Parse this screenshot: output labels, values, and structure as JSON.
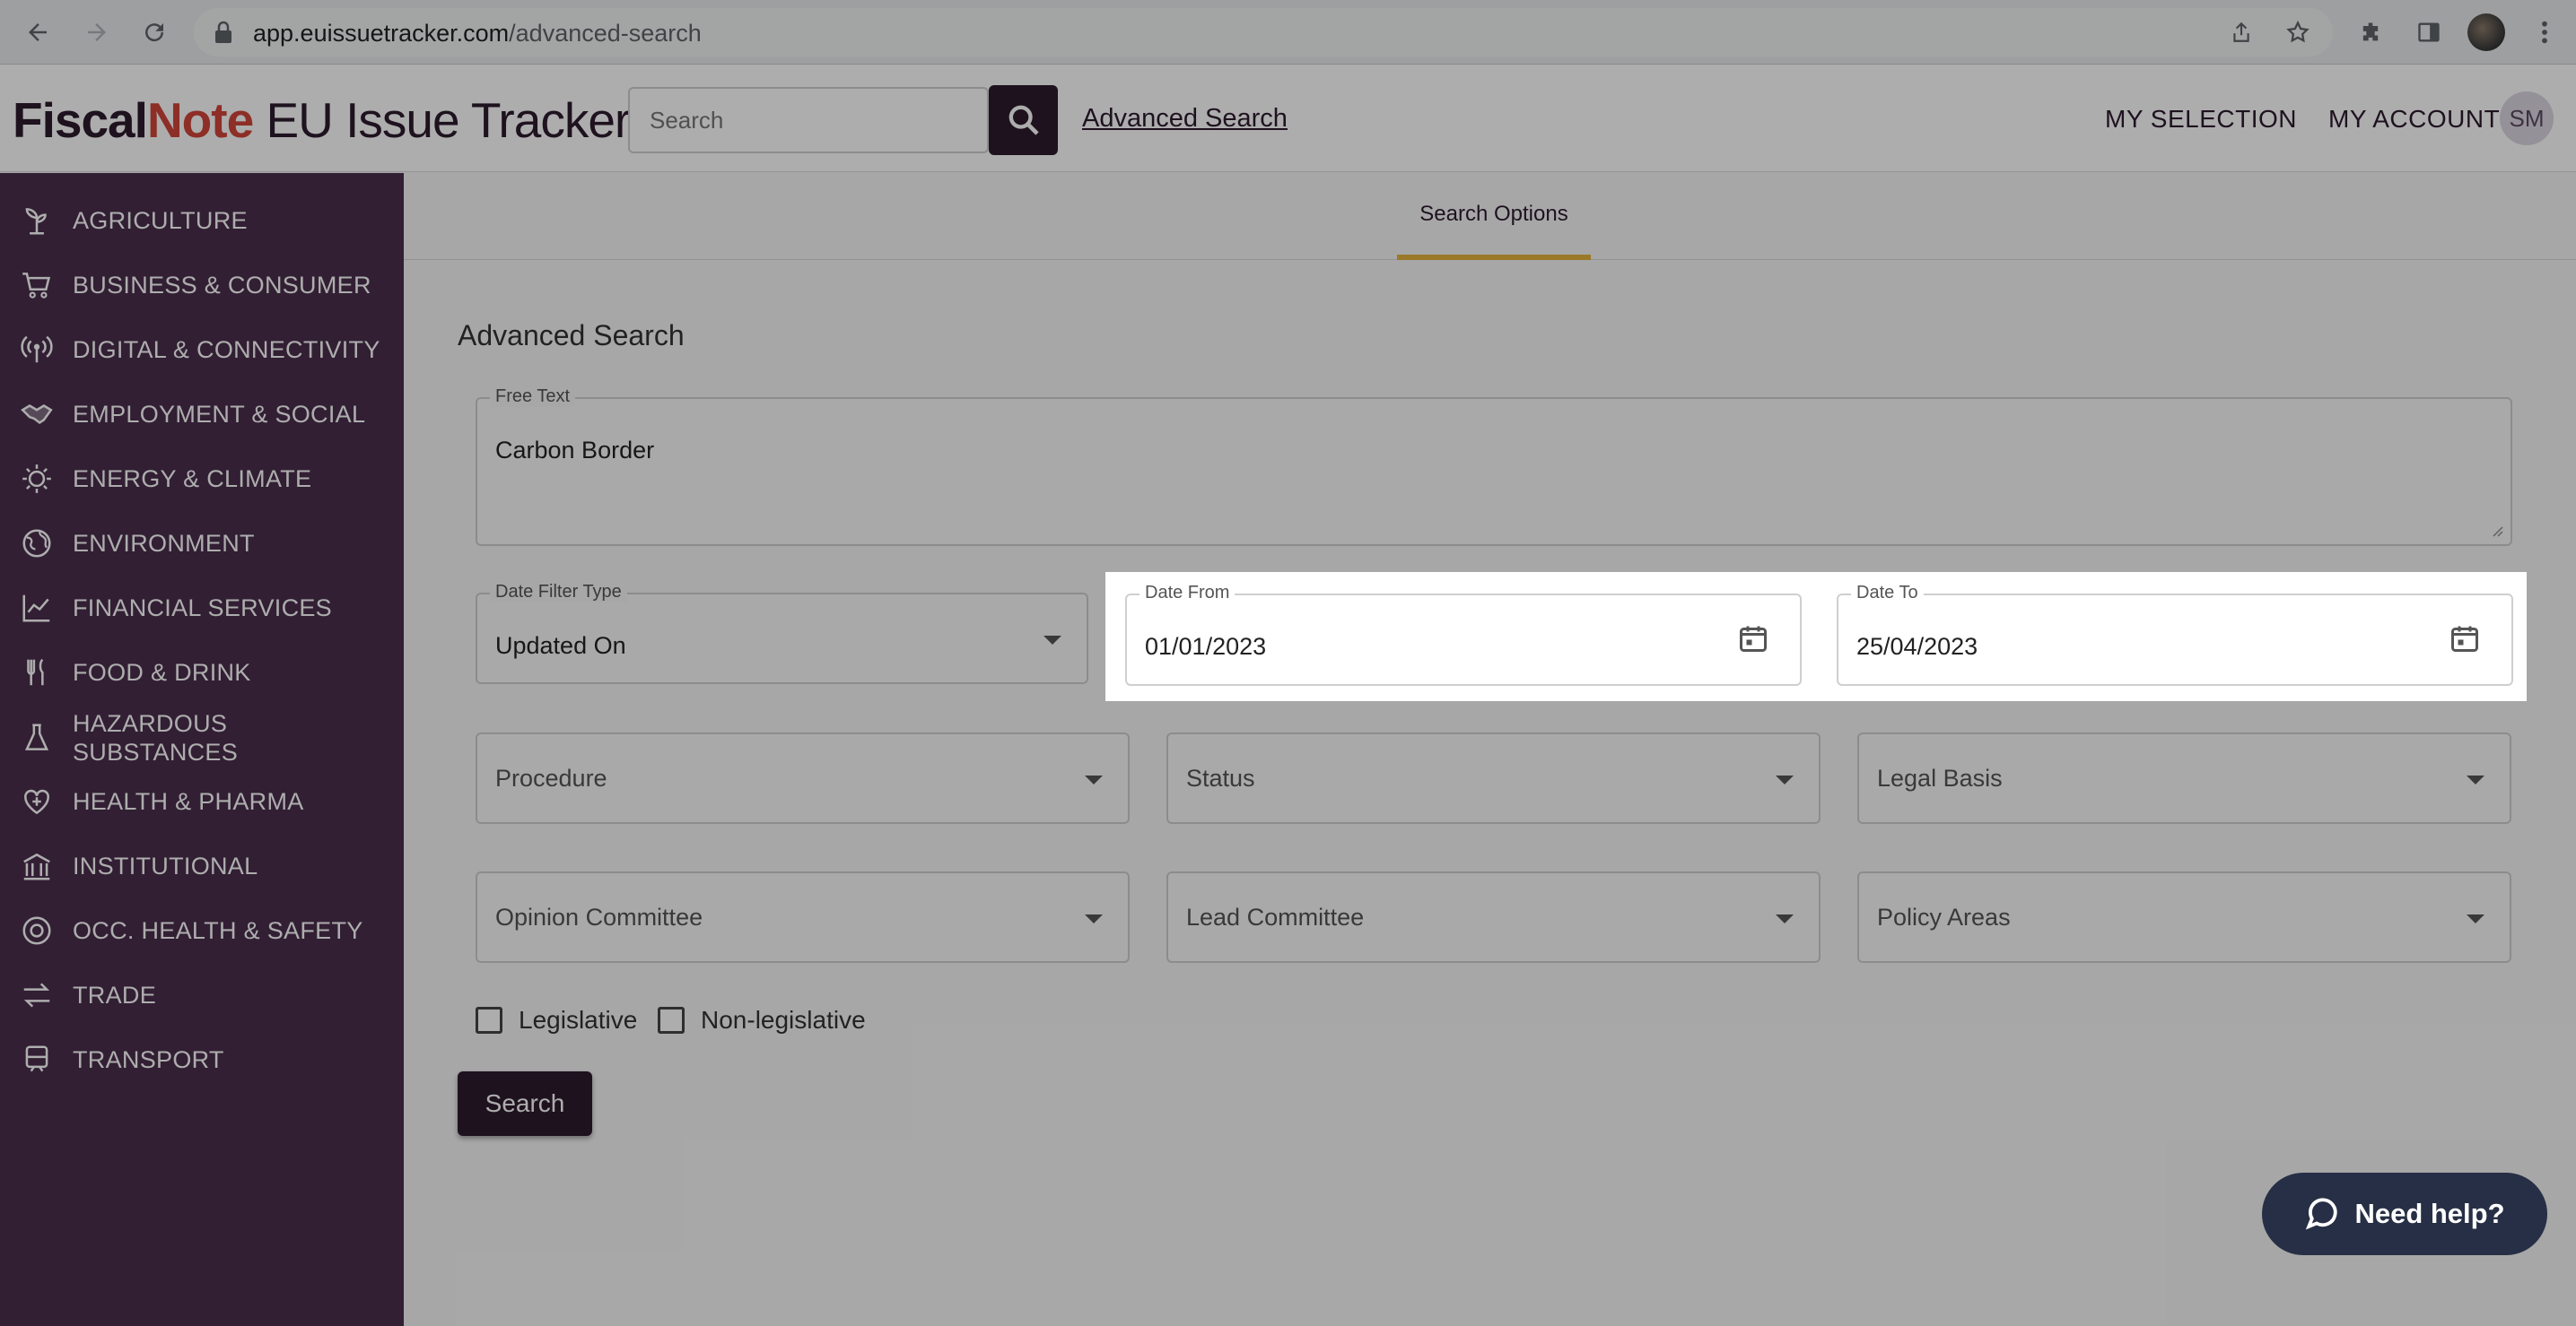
{
  "browser": {
    "url_domain": "app.euissuetracker.com",
    "url_path": "/advanced-search"
  },
  "header": {
    "brand_part1": "Fiscal",
    "brand_part2": "Note",
    "brand_part3": " EU Issue Tracker",
    "search_placeholder": "Search",
    "advanced_search_link": "Advanced Search",
    "my_selection": "MY SELECTION",
    "my_account": "MY ACCOUNT",
    "user_initials": "SM"
  },
  "sidebar": {
    "items": [
      {
        "label": "AGRICULTURE",
        "icon": "plant-icon"
      },
      {
        "label": "BUSINESS & CONSUMER",
        "icon": "cart-icon"
      },
      {
        "label": "DIGITAL & CONNECTIVITY",
        "icon": "broadcast-icon"
      },
      {
        "label": "EMPLOYMENT & SOCIAL",
        "icon": "handshake-icon"
      },
      {
        "label": "ENERGY & CLIMATE",
        "icon": "sun-icon"
      },
      {
        "label": "ENVIRONMENT",
        "icon": "globe-icon"
      },
      {
        "label": "FINANCIAL SERVICES",
        "icon": "chart-icon"
      },
      {
        "label": "FOOD & DRINK",
        "icon": "utensils-icon"
      },
      {
        "label": "HAZARDOUS SUBSTANCES",
        "label_line1": "HAZARDOUS",
        "label_line2": "SUBSTANCES",
        "icon": "flask-icon"
      },
      {
        "label": "HEALTH & PHARMA",
        "icon": "heart-plus-icon"
      },
      {
        "label": "INSTITUTIONAL",
        "icon": "building-icon"
      },
      {
        "label": "OCC. HEALTH & SAFETY",
        "icon": "lifebuoy-icon"
      },
      {
        "label": "TRADE",
        "icon": "arrows-icon"
      },
      {
        "label": "TRANSPORT",
        "icon": "train-icon"
      }
    ]
  },
  "main": {
    "tab_label": "Search Options",
    "section_title": "Advanced Search",
    "free_text": {
      "label": "Free Text",
      "value": "Carbon Border"
    },
    "date_filter_type": {
      "label": "Date Filter Type",
      "value": "Updated On"
    },
    "date_from": {
      "label": "Date From",
      "value": "01/01/2023"
    },
    "date_to": {
      "label": "Date To",
      "value": "25/04/2023"
    },
    "dropdowns": [
      {
        "placeholder": "Procedure"
      },
      {
        "placeholder": "Status"
      },
      {
        "placeholder": "Legal Basis"
      },
      {
        "placeholder": "Opinion Committee"
      },
      {
        "placeholder": "Lead Committee"
      },
      {
        "placeholder": "Policy Areas"
      }
    ],
    "checkboxes": [
      {
        "label": "Legislative",
        "checked": false
      },
      {
        "label": "Non-legislative",
        "checked": false
      }
    ],
    "search_button": "Search",
    "help_button": "Need help?"
  },
  "colors": {
    "brand_dark": "#2d1b2e",
    "brand_red": "#d0453a",
    "sidebar_bg": "#4a2e4d",
    "tab_underline": "#e3b33b",
    "help_bg": "#262f45"
  }
}
